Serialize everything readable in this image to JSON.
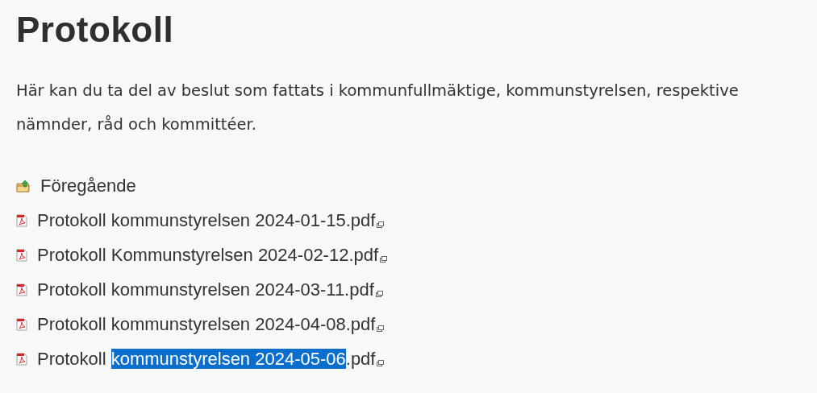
{
  "title": "Protokoll",
  "intro": "Här kan du ta del av beslut som fattats i kommunfullmäktige, kommunstyrelsen, respektive nämnder, råd och kommittéer.",
  "links": [
    {
      "kind": "folder",
      "parts": [
        {
          "text": "Föregående",
          "selected": false
        }
      ],
      "external": false
    },
    {
      "kind": "pdf",
      "parts": [
        {
          "text": "Protokoll kommunstyrelsen 2024-01-15.pdf",
          "selected": false
        }
      ],
      "external": true
    },
    {
      "kind": "pdf",
      "parts": [
        {
          "text": "Protokoll Kommunstyrelsen 2024-02-12.pdf",
          "selected": false
        }
      ],
      "external": true
    },
    {
      "kind": "pdf",
      "parts": [
        {
          "text": "Protokoll kommunstyrelsen 2024-03-11.pdf",
          "selected": false
        }
      ],
      "external": true
    },
    {
      "kind": "pdf",
      "parts": [
        {
          "text": "Protokoll kommunstyrelsen 2024-04-08.pdf",
          "selected": false
        }
      ],
      "external": true
    },
    {
      "kind": "pdf",
      "parts": [
        {
          "text": "Protokoll ",
          "selected": false
        },
        {
          "text": "kommunstyrelsen 2024-05-06",
          "selected": true
        },
        {
          "text": ".pdf",
          "selected": false
        }
      ],
      "external": true
    }
  ]
}
